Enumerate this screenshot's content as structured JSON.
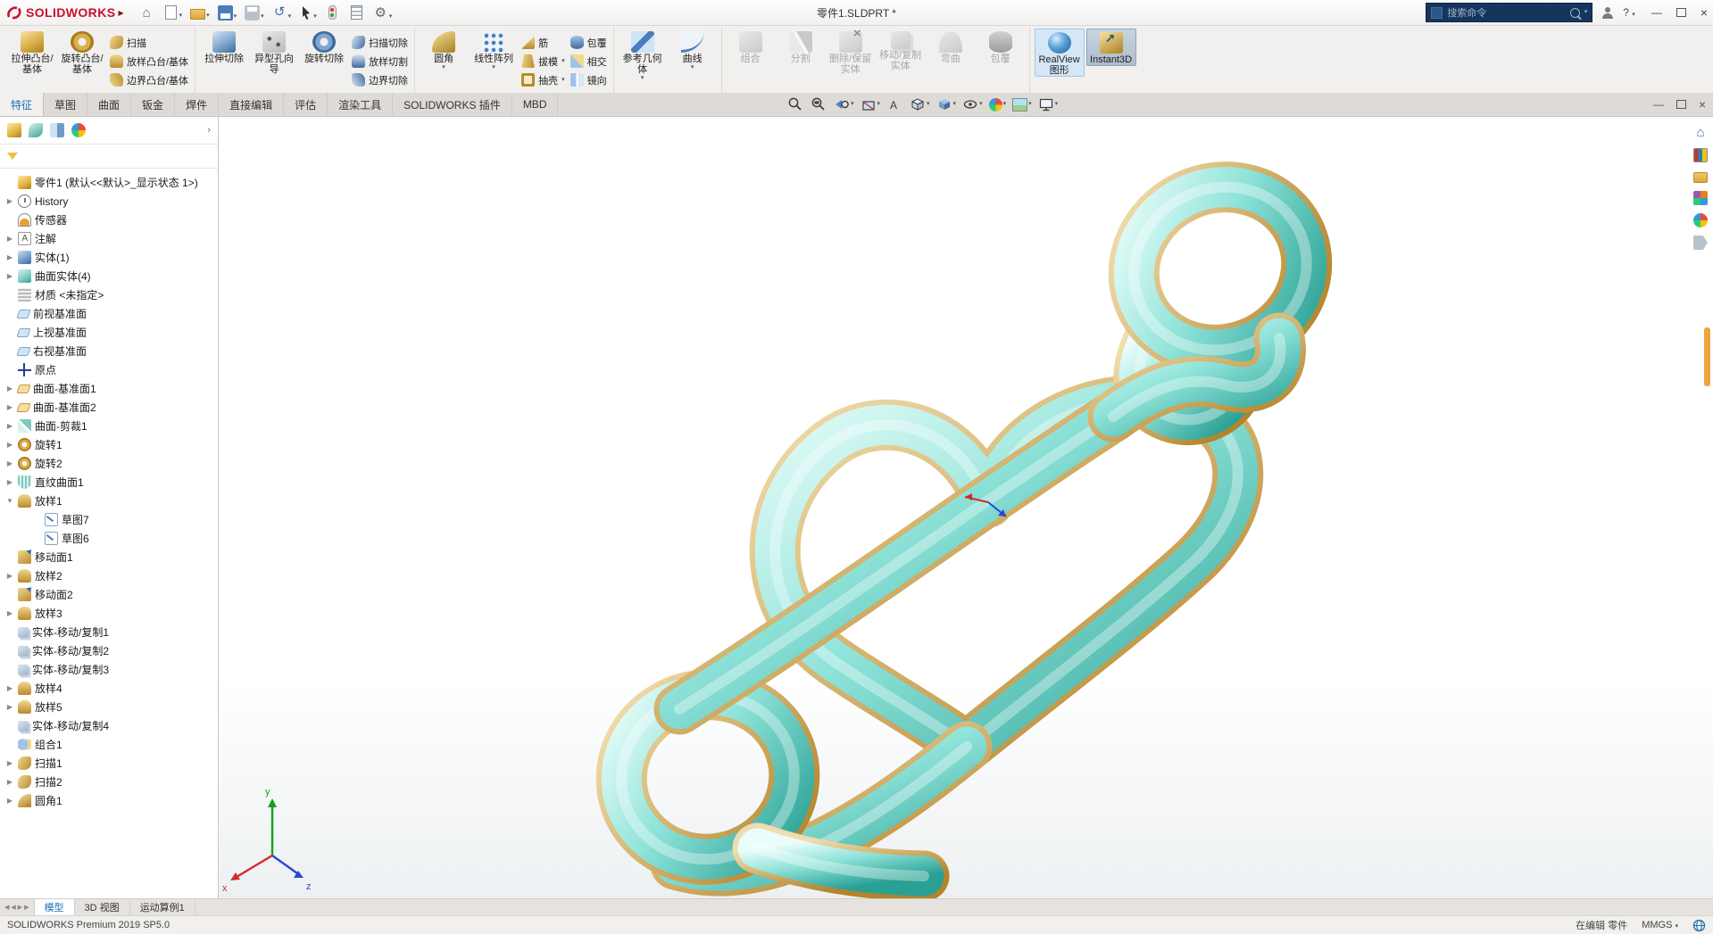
{
  "title_bar": {
    "app_name": "SOLIDWORKS",
    "doc_title": "零件1.SLDPRT *",
    "search_placeholder": "搜索命令",
    "help_label": "?",
    "minimize_glyph": "—",
    "close_glyph": "×"
  },
  "quick_access": {
    "items": [
      {
        "icon": "home",
        "dd": ""
      },
      {
        "icon": "new-document",
        "dd": "▾"
      },
      {
        "icon": "open",
        "dd": "▾"
      },
      {
        "icon": "save",
        "dd": "▾"
      },
      {
        "icon": "print",
        "dd": "▾"
      },
      {
        "icon": "undo",
        "dd": "▾"
      },
      {
        "icon": "select",
        "dd": "▾"
      },
      {
        "icon": "rebuild",
        "dd": ""
      },
      {
        "icon": "file-properties",
        "dd": ""
      },
      {
        "icon": "options",
        "dd": "▾"
      }
    ],
    "home_glyph": "⌂",
    "undo_glyph": "↺",
    "options_glyph": "⚙"
  },
  "ribbon": {
    "g0": {
      "big": [
        {
          "label": "拉伸凸台/基体",
          "icon": "extrude-boss",
          "dd": ""
        },
        {
          "label": "旋转凸台/基体",
          "icon": "revolve-boss",
          "dd": ""
        }
      ],
      "small": [
        {
          "label": "扫描",
          "icon": "sweep",
          "dd": ""
        },
        {
          "label": "放样凸台/基体",
          "icon": "loft",
          "dd": ""
        },
        {
          "label": "边界凸台/基体",
          "icon": "boundary",
          "dd": ""
        }
      ]
    },
    "g1": {
      "big": [
        {
          "label": "拉伸切除",
          "icon": "extrude-cut",
          "dd": ""
        },
        {
          "label": "异型孔向导",
          "icon": "hole-wizard",
          "dd": ""
        },
        {
          "label": "旋转切除",
          "icon": "revolve-cut",
          "dd": ""
        }
      ],
      "small": [
        {
          "label": "扫描切除",
          "icon": "sweep-cut",
          "dd": ""
        },
        {
          "label": "放样切割",
          "icon": "loft-cut",
          "dd": ""
        },
        {
          "label": "边界切除",
          "icon": "boundary-cut",
          "dd": ""
        }
      ]
    },
    "g2": {
      "big": [
        {
          "label": "圆角",
          "icon": "fillet",
          "dd": "▾"
        },
        {
          "label": "线性阵列",
          "icon": "linear-pattern",
          "dd": "▾"
        }
      ],
      "smallA": [
        {
          "label": "筋",
          "icon": "rib",
          "dd": ""
        },
        {
          "label": "拔模",
          "icon": "draft",
          "dd": "▾"
        },
        {
          "label": "抽壳",
          "icon": "shell",
          "dd": "▾"
        }
      ],
      "smallB": [
        {
          "label": "包覆",
          "icon": "wrap",
          "dd": ""
        },
        {
          "label": "相交",
          "icon": "intersect",
          "dd": ""
        },
        {
          "label": "镜向",
          "icon": "mirror",
          "dd": ""
        }
      ]
    },
    "g3": {
      "big": [
        {
          "label": "参考几何体",
          "icon": "reference-geometry",
          "dd": "▾"
        },
        {
          "label": "曲线",
          "icon": "curves",
          "dd": "▾"
        }
      ]
    },
    "g4": {
      "big": [
        {
          "label": "组合",
          "icon": "combine",
          "dd": ""
        },
        {
          "label": "分割",
          "icon": "split",
          "dd": ""
        },
        {
          "label": "删除/保留实体",
          "icon": "delete-keep-body",
          "dd": ""
        },
        {
          "label": "移动/复制实体",
          "icon": "move-copy-body",
          "dd": ""
        },
        {
          "label": "弯曲",
          "icon": "flex",
          "dd": ""
        },
        {
          "label": "包覆",
          "icon": "wrap-2",
          "dd": ""
        }
      ]
    },
    "g5": {
      "big": [
        {
          "label": "RealView 图形",
          "icon": "realview",
          "dd": ""
        },
        {
          "label": "Instant3D",
          "icon": "instant3d",
          "dd": ""
        }
      ]
    }
  },
  "command_tabs": {
    "items": [
      "特征",
      "草图",
      "曲面",
      "钣金",
      "焊件",
      "直接编辑",
      "评估",
      "渲染工具",
      "SOLIDWORKS 插件",
      "MBD"
    ],
    "active": "特征"
  },
  "view_toolbar": {
    "items": [
      {
        "name": "zoom-fit",
        "dd": ""
      },
      {
        "name": "zoom-to-area",
        "dd": ""
      },
      {
        "name": "previous-view",
        "dd": "▾"
      },
      {
        "name": "section-view",
        "dd": "▾"
      },
      {
        "name": "dynamic-annotation",
        "dd": ""
      },
      {
        "name": "view-orientation",
        "dd": "▾"
      },
      {
        "name": "display-style",
        "dd": "▾"
      },
      {
        "name": "hide-show-items",
        "dd": "▾"
      },
      {
        "name": "edit-appearance",
        "dd": "▾"
      },
      {
        "name": "apply-scene",
        "dd": "▾"
      },
      {
        "name": "view-settings",
        "dd": "▾"
      }
    ]
  },
  "doc_window": {
    "minimize": "—",
    "close": "×"
  },
  "feature_tree": {
    "manager_tabs": [
      "featuremanager",
      "propertymanager",
      "configurationmanager",
      "displaymanager"
    ],
    "expand_chevron": "›",
    "root": {
      "label": "零件1 (默认<<默认>_显示状态 1>)",
      "icon": "part"
    },
    "items": [
      {
        "label": "History",
        "icon": "history",
        "arrow": "▶",
        "ind": 0
      },
      {
        "label": "传感器",
        "icon": "sensor",
        "arrow": "",
        "ind": 0
      },
      {
        "label": "注解",
        "icon": "annotations",
        "arrow": "▶",
        "ind": 0
      },
      {
        "label": "实体(1)",
        "icon": "solid-folder",
        "arrow": "▶",
        "ind": 0
      },
      {
        "label": "曲面实体(4)",
        "icon": "surface-folder",
        "arrow": "▶",
        "ind": 0
      },
      {
        "label": "材质 <未指定>",
        "icon": "material",
        "arrow": "",
        "ind": 0
      },
      {
        "label": "前视基准面",
        "icon": "plane",
        "arrow": "",
        "ind": 0
      },
      {
        "label": "上视基准面",
        "icon": "plane",
        "arrow": "",
        "ind": 0
      },
      {
        "label": "右视基准面",
        "icon": "plane",
        "arrow": "",
        "ind": 0
      },
      {
        "label": "原点",
        "icon": "origin",
        "arrow": "",
        "ind": 0
      },
      {
        "label": "曲面-基准面1",
        "icon": "surf-plane",
        "arrow": "▶",
        "ind": 0
      },
      {
        "label": "曲面-基准面2",
        "icon": "surf-plane",
        "arrow": "▶",
        "ind": 0
      },
      {
        "label": "曲面-剪裁1",
        "icon": "surf-trim",
        "arrow": "▶",
        "ind": 0
      },
      {
        "label": "旋转1",
        "icon": "revolve-f",
        "arrow": "▶",
        "ind": 0
      },
      {
        "label": "旋转2",
        "icon": "revolve-f",
        "arrow": "▶",
        "ind": 0
      },
      {
        "label": "直纹曲面1",
        "icon": "ruled-surface",
        "arrow": "▶",
        "ind": 0
      },
      {
        "label": "放样1",
        "icon": "loft-f",
        "arrow": "▼",
        "ind": 0
      },
      {
        "label": "草图7",
        "icon": "sketch",
        "arrow": "",
        "ind": 1
      },
      {
        "label": "草图6",
        "icon": "sketch",
        "arrow": "",
        "ind": 1
      },
      {
        "label": "移动面1",
        "icon": "move-face",
        "arrow": "",
        "ind": 0
      },
      {
        "label": "放样2",
        "icon": "loft-f",
        "arrow": "▶",
        "ind": 0
      },
      {
        "label": "移动面2",
        "icon": "move-face",
        "arrow": "",
        "ind": 0
      },
      {
        "label": "放样3",
        "icon": "loft-f",
        "arrow": "▶",
        "ind": 0
      },
      {
        "label": "实体-移动/复制1",
        "icon": "move-copy",
        "arrow": "",
        "ind": 0
      },
      {
        "label": "实体-移动/复制2",
        "icon": "move-copy",
        "arrow": "",
        "ind": 0
      },
      {
        "label": "实体-移动/复制3",
        "icon": "move-copy",
        "arrow": "",
        "ind": 0
      },
      {
        "label": "放样4",
        "icon": "loft-f",
        "arrow": "▶",
        "ind": 0
      },
      {
        "label": "放样5",
        "icon": "loft-f",
        "arrow": "▶",
        "ind": 0
      },
      {
        "label": "实体-移动/复制4",
        "icon": "move-copy",
        "arrow": "",
        "ind": 0
      },
      {
        "label": "组合1",
        "icon": "combine-f",
        "arrow": "",
        "ind": 0
      },
      {
        "label": "扫描1",
        "icon": "sweep-f",
        "arrow": "▶",
        "ind": 0
      },
      {
        "label": "扫描2",
        "icon": "sweep-f",
        "arrow": "▶",
        "ind": 0
      },
      {
        "label": "圆角1",
        "icon": "fillet-f",
        "arrow": "▶",
        "ind": 0
      }
    ]
  },
  "task_pane": {
    "icons": [
      "sw-resources",
      "design-library",
      "file-explorer",
      "view-palette",
      "appearances",
      "custom-properties"
    ],
    "home_glyph": "⌂"
  },
  "viewport": {
    "triad": {
      "x": "x",
      "y": "y",
      "z": "z"
    },
    "model_colors": {
      "tube_teal": "#7fd9cf",
      "rim_gold": "#c9a227",
      "background": "#ffffff"
    }
  },
  "bottom_tabs": {
    "nav": [
      "◀",
      "◀",
      "▶",
      "▶"
    ],
    "tabs": [
      "模型",
      "3D 视图",
      "运动算例1"
    ],
    "active": "模型"
  },
  "status_bar": {
    "left": "SOLIDWORKS Premium 2019 SP5.0",
    "mode": "在编辑 零件",
    "units": "MMGS",
    "units_dd": "▾"
  }
}
